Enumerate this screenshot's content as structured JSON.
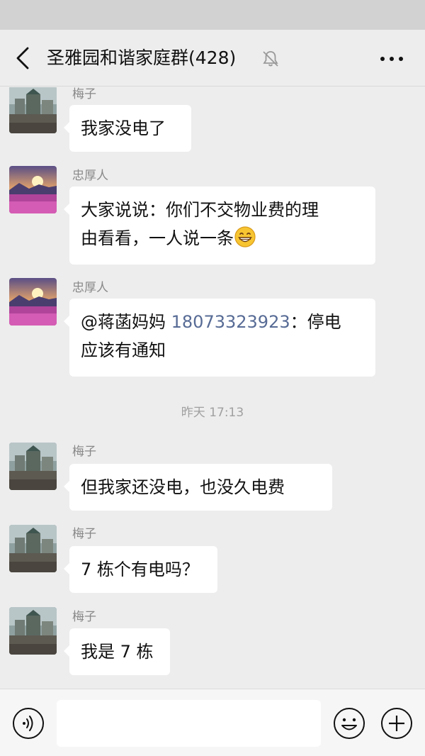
{
  "header": {
    "title": "圣雅园和谐家庭群(428)",
    "back_icon": "chevron-left-icon",
    "mute_icon": "bell-muted-icon",
    "more_icon": "more-dots-icon"
  },
  "messages": [
    {
      "sender": "梅子",
      "avatar": "building-photo",
      "lines": [
        "我家没电了"
      ]
    },
    {
      "sender": "忠厚人",
      "avatar": "sunset-flowers-photo",
      "lines": [
        "大家说说：你们不交物业费的理",
        "由看看，一人说一条"
      ],
      "emoji": "grinning-face-icon"
    },
    {
      "sender": "忠厚人",
      "avatar": "sunset-flowers-photo",
      "mention": "@蒋菡妈妈 ",
      "phone": "18073323923",
      "after_phone": "：停电",
      "line2": "应该有通知"
    },
    {
      "timestamp": "昨天 17:13"
    },
    {
      "sender": "梅子",
      "avatar": "building-photo",
      "lines": [
        "但我家还没电，也没久电费"
      ]
    },
    {
      "sender": "梅子",
      "avatar": "building-photo",
      "lines": [
        "7 栋个有电吗？"
      ]
    },
    {
      "sender": "梅子",
      "avatar": "building-photo",
      "lines": [
        "我是 7 栋"
      ]
    }
  ],
  "input_bar": {
    "voice_icon": "voice-icon",
    "text_value": "",
    "emoji_icon": "emoji-icon",
    "plus_icon": "plus-icon"
  },
  "colors": {
    "background": "#ededed",
    "bubble": "#ffffff",
    "link": "#576b95",
    "sender_name": "#888888"
  }
}
